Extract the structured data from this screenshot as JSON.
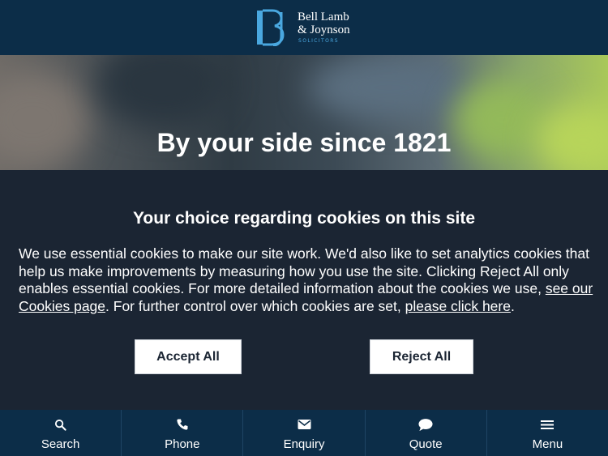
{
  "brand": {
    "line1": "Bell Lamb",
    "line2": "& Joynson",
    "tagline": "SOLICITORS",
    "accent": "#4aa8e0"
  },
  "hero": {
    "title": "By your side since 1821"
  },
  "cookie_banner": {
    "title": "Your choice regarding cookies on this site",
    "text_part1": "We use essential cookies to make our site work. We'd also like to set analytics cookies that help us make improvements by measuring how you use the site. Clicking Reject All only enables essential cookies. For more detailed information about the cookies we use, ",
    "link1": "see our Cookies page",
    "text_part2": ". For further control over which cookies are set, ",
    "link2": "please click here",
    "text_part3": ".",
    "accept_label": "Accept All",
    "reject_label": "Reject All"
  },
  "bottom_nav": {
    "items": [
      {
        "label": "Search",
        "icon": "search-icon"
      },
      {
        "label": "Phone",
        "icon": "phone-icon"
      },
      {
        "label": "Enquiry",
        "icon": "envelope-icon"
      },
      {
        "label": "Quote",
        "icon": "chat-bubble-icon"
      },
      {
        "label": "Menu",
        "icon": "hamburger-menu-icon"
      }
    ]
  }
}
